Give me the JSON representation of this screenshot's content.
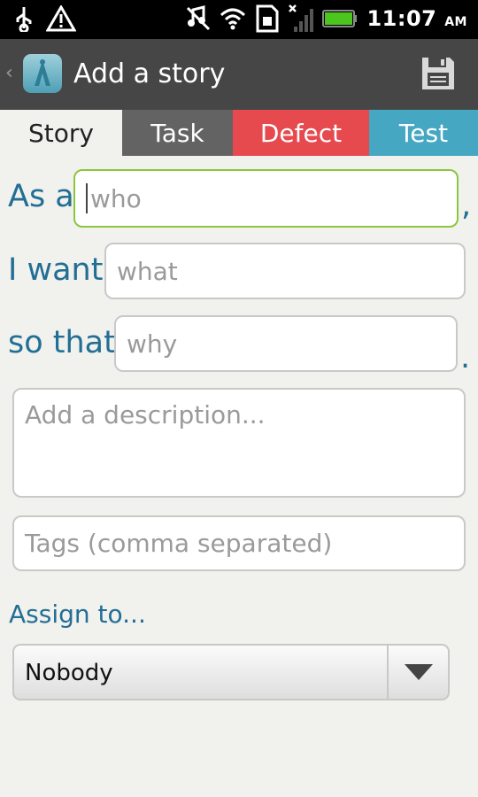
{
  "status_bar": {
    "time": "11:07",
    "ampm": "AM"
  },
  "action_bar": {
    "title": "Add a story"
  },
  "tabs": [
    {
      "label": "Story",
      "color": "#f1f1ee"
    },
    {
      "label": "Task",
      "color": "#636363"
    },
    {
      "label": "Defect",
      "color": "#e64a4f"
    },
    {
      "label": "Test",
      "color": "#45a7c2"
    }
  ],
  "form": {
    "as_a_label": "As a",
    "who_placeholder": "who",
    "who_suffix": ",",
    "i_want_label": "I want",
    "what_placeholder": "what",
    "so_that_label": "so that",
    "why_placeholder": "why",
    "why_suffix": ".",
    "description_placeholder": "Add a description...",
    "tags_placeholder": "Tags (comma separated)",
    "assign_label": "Assign to...",
    "assign_value": "Nobody"
  },
  "colors": {
    "accent_text": "#226e94",
    "focus_border": "#8ec53e"
  }
}
